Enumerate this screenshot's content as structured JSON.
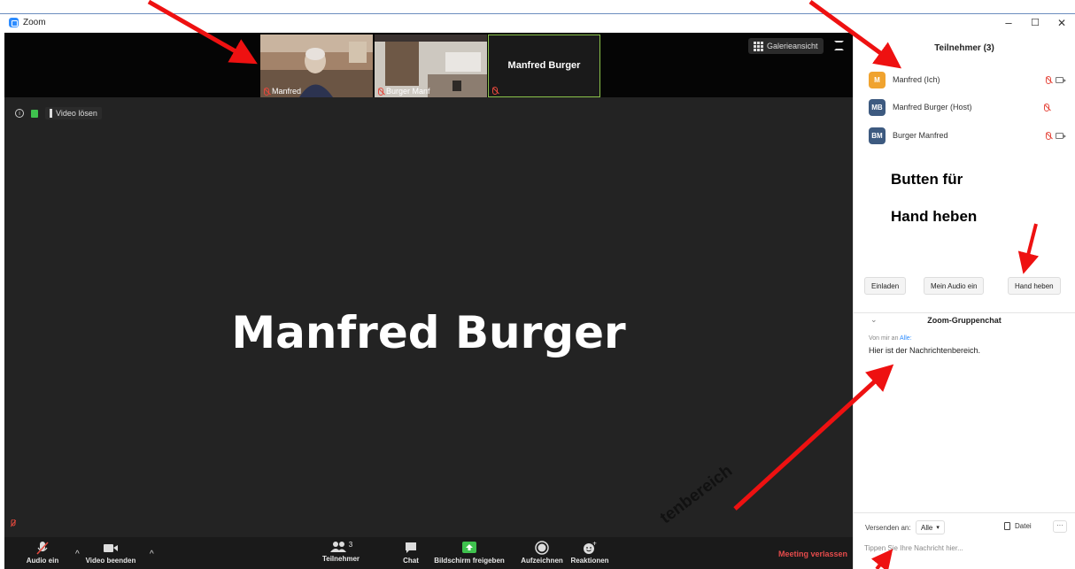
{
  "window": {
    "title": "Zoom",
    "controls": [
      "–",
      "☐",
      "✕"
    ]
  },
  "thumbnails": [
    {
      "name": "Manfred"
    },
    {
      "name": "Burger Manf"
    },
    {
      "name": "Manfred Burger"
    }
  ],
  "view": {
    "gallery_label": "Galerieansicht",
    "video_unlock_label": "Video lösen"
  },
  "speaker": {
    "name": "Manfred Burger"
  },
  "toolbar": {
    "audio_label": "Audio ein",
    "video_label": "Video beenden",
    "participants_label": "Teilnehmer",
    "participants_count": "3",
    "chat_label": "Chat",
    "share_label": "Bildschirm freigeben",
    "record_label": "Aufzeichnen",
    "reactions_label": "Reaktionen",
    "leave_label": "Meeting verlassen"
  },
  "panel": {
    "title": "Teilnehmer (3)",
    "participants": [
      {
        "initials": "M",
        "name": "Manfred (Ich)",
        "color": "#f0a32f"
      },
      {
        "initials": "MB",
        "name": "Manfred Burger (Host)",
        "color": "#3d5a80"
      },
      {
        "initials": "BM",
        "name": "Burger Manfred",
        "color": "#3d5a80"
      }
    ],
    "buttons": {
      "invite": "Einladen",
      "audio": "Mein Audio ein",
      "raise_hand": "Hand heben"
    }
  },
  "annotations": {
    "hand_note_1": "Butten für",
    "hand_note_2": "Hand heben",
    "message_area": "tenbereich"
  },
  "chat": {
    "title": "Zoom-Gruppenchat",
    "from_prefix": "Von mir an ",
    "to": "Alle:",
    "message": "Hier ist der Nachrichtenbereich.",
    "send_to_label": "Versenden an:",
    "send_to_value": "Alle",
    "file_label": "Datei",
    "more_label": "···",
    "input_placeholder": "Tippen Sie Ihre Nachricht hier..."
  },
  "colors": {
    "accent": "#2d8cff",
    "leave": "#e54b4b",
    "arrow": "#ee1111",
    "share_green": "#3fc24e"
  }
}
